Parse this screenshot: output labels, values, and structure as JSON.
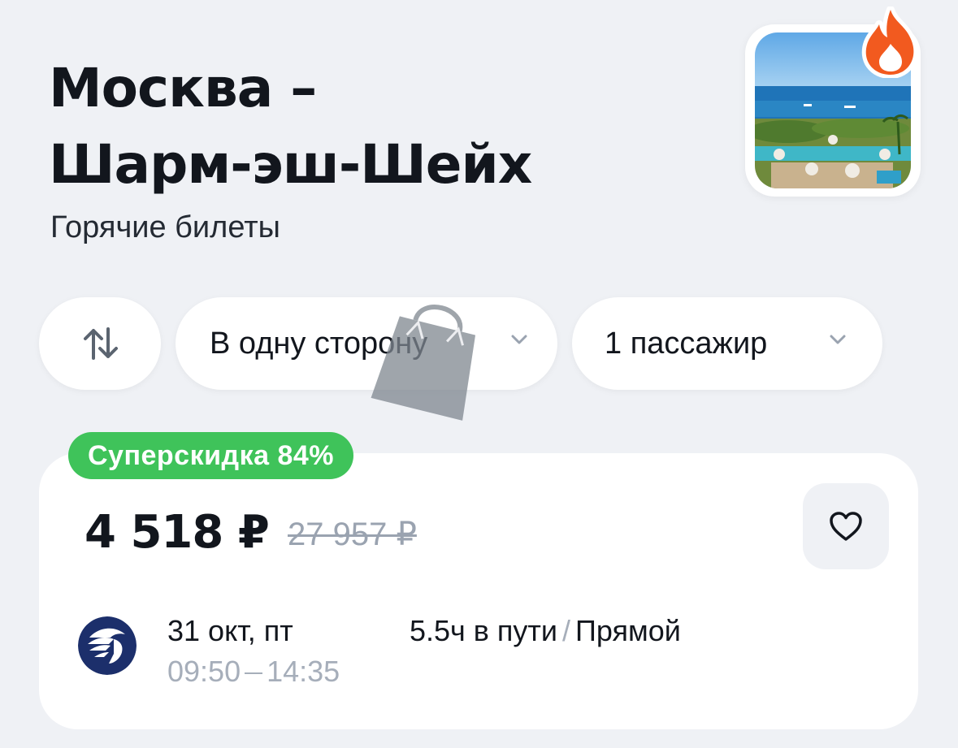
{
  "header": {
    "title_line1": "Москва –",
    "title_line2": "Шарм-эш-Шейх",
    "subtitle": "Горячие билеты"
  },
  "thumbnail": {
    "image": "resort-beach-photo",
    "badge_icon": "fire-icon"
  },
  "filters": {
    "swap_icon": "swap-arrows-icon",
    "trip_type": "В одну сторону",
    "passengers": "1 пассажир"
  },
  "offer": {
    "badge": "Суперскидка 84%",
    "price": "4 518 ₽",
    "old_price": "27 957 ₽",
    "favorite_icon": "heart-icon",
    "airline_logo": "airline-falcon-logo",
    "date": "31 окт, пт",
    "depart_time": "09:50",
    "arrive_time": "14:35",
    "duration": "5.5ч в пути",
    "separator": "/",
    "stops": "Прямой"
  },
  "colors": {
    "background": "#eff1f5",
    "badge_green": "#3fc35a",
    "fire_orange": "#f25a1f",
    "muted_text": "#a6aeba"
  }
}
